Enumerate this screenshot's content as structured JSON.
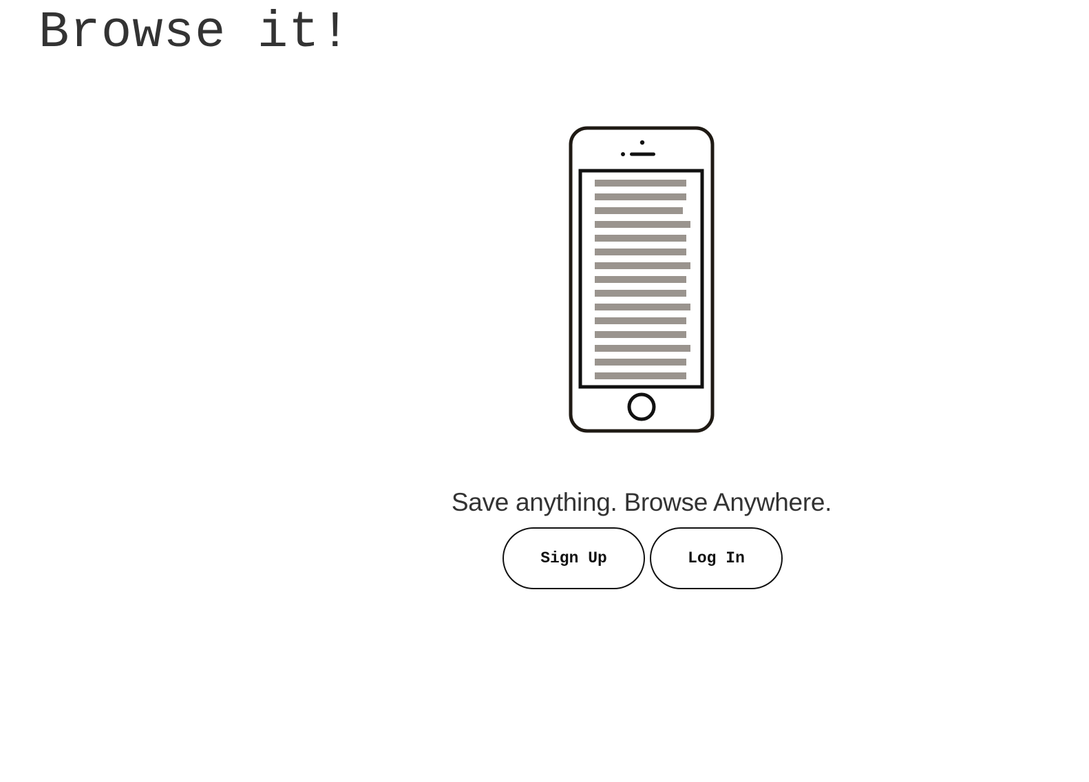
{
  "header": {
    "app_title": "Browse it!"
  },
  "hero": {
    "icon": "smartphone-reading-icon",
    "tagline": "Save anything. Browse Anywhere."
  },
  "actions": {
    "signup_label": "Sign Up",
    "login_label": "Log In"
  },
  "colors": {
    "text": "#333333",
    "phone_outline": "#1f1a14",
    "screen_lines": "#9a948e",
    "background": "#ffffff"
  }
}
